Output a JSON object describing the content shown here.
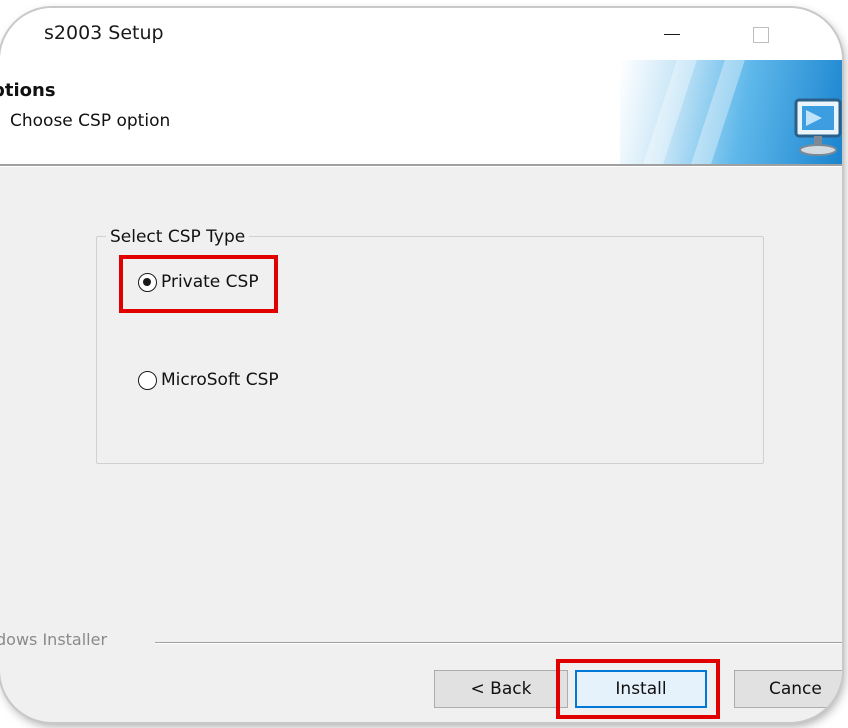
{
  "window": {
    "title": "s2003 Setup"
  },
  "header": {
    "title": "ptions",
    "subtitle": "Choose CSP option"
  },
  "csp_group": {
    "label": "Select CSP Type",
    "options": [
      {
        "label": "Private CSP",
        "selected": true
      },
      {
        "label": "MicroSoft CSP",
        "selected": false
      }
    ]
  },
  "footer": {
    "label": "dows Installer"
  },
  "buttons": {
    "back": "< Back",
    "install": "Install",
    "cancel": "Cance"
  },
  "icons": {
    "minimize": "minimize-icon",
    "maximize": "maximize-icon",
    "banner": "computer-monitor-icon"
  },
  "colors": {
    "highlight": "#e00000",
    "focus_border": "#0078d7",
    "dialog_background": "#f0f0f0"
  }
}
